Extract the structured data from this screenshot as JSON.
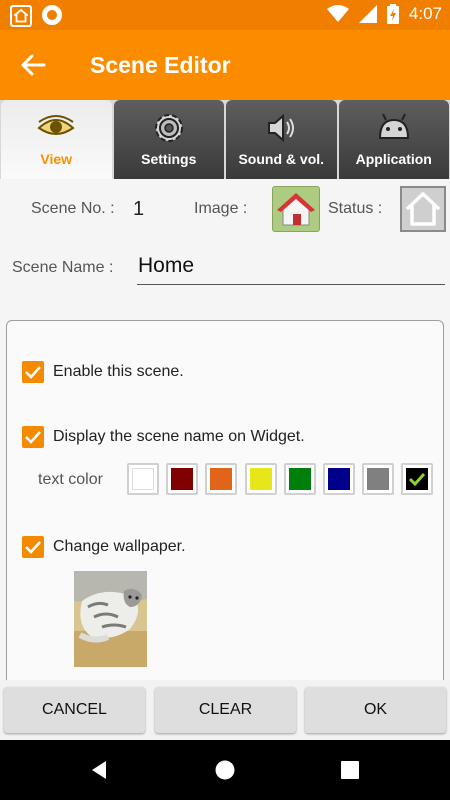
{
  "status_bar": {
    "time": "4:07",
    "icons": [
      "home-icon",
      "ring-icon",
      "wifi-icon",
      "signal-icon",
      "battery-icon"
    ]
  },
  "app_bar": {
    "title": "Scene Editor",
    "back_icon": "arrow-back-icon"
  },
  "tabs": [
    {
      "label": "View",
      "icon": "eye-icon",
      "active": true
    },
    {
      "label": "Settings",
      "icon": "gear-icon",
      "active": false
    },
    {
      "label": "Sound & vol.",
      "icon": "speaker-icon",
      "active": false
    },
    {
      "label": "Application",
      "icon": "android-icon",
      "active": false
    }
  ],
  "info": {
    "scene_no_label": "Scene No. :",
    "scene_no": "1",
    "image_label": "Image :",
    "status_label": "Status :",
    "scene_name_label": "Scene Name :",
    "scene_name": "Home"
  },
  "options": {
    "enable": {
      "label": "Enable this scene.",
      "checked": true
    },
    "display_name": {
      "label": "Display the scene name on Widget.",
      "checked": true
    },
    "text_color_label": "text color",
    "text_colors": [
      "#ffffff",
      "#800000",
      "#e0641a",
      "#e6e619",
      "#00800a",
      "#00008a",
      "#808080",
      "#000000"
    ],
    "selected_color": "#000000",
    "change_wallpaper": {
      "label": "Change wallpaper.",
      "checked": true
    }
  },
  "buttons": {
    "cancel": "CANCEL",
    "clear": "CLEAR",
    "ok": "OK"
  },
  "colors": {
    "accent": "#fb8c00",
    "status_bar": "#f07f00",
    "checkbox": "#f48a00",
    "active_tab_text": "#f49200"
  }
}
